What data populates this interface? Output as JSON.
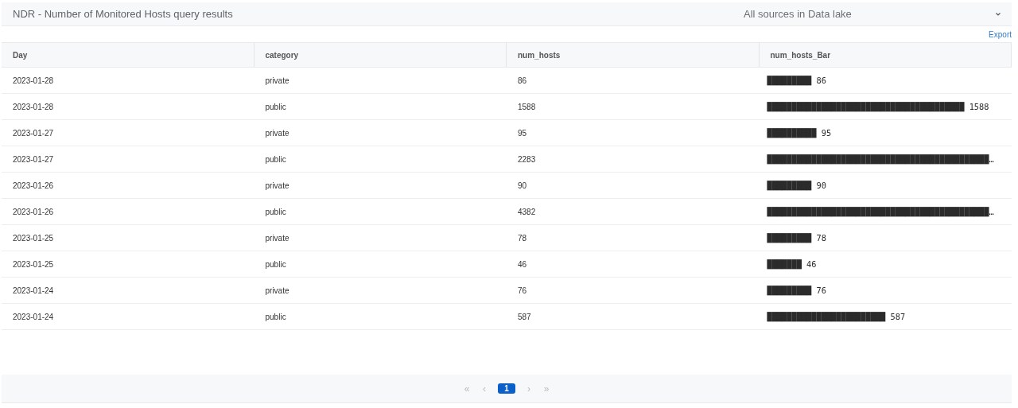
{
  "header": {
    "title": "NDR - Number of Monitored Hosts query results",
    "source_select": {
      "value": "All sources in Data lake"
    }
  },
  "export_link": "Export",
  "table": {
    "columns": [
      "Day",
      "category",
      "num_hosts",
      "num_hosts_Bar"
    ],
    "rows": [
      {
        "day": "2023-01-28",
        "category": "private",
        "num_hosts": "86",
        "num_hosts_bar": "█████████ 86"
      },
      {
        "day": "2023-01-28",
        "category": "public",
        "num_hosts": "1588",
        "num_hosts_bar": "████████████████████████████████████████ 1588"
      },
      {
        "day": "2023-01-27",
        "category": "private",
        "num_hosts": "95",
        "num_hosts_bar": "██████████ 95"
      },
      {
        "day": "2023-01-27",
        "category": "public",
        "num_hosts": "2283",
        "num_hosts_bar": "█████████████████████████████████████████████…"
      },
      {
        "day": "2023-01-26",
        "category": "private",
        "num_hosts": "90",
        "num_hosts_bar": "█████████ 90"
      },
      {
        "day": "2023-01-26",
        "category": "public",
        "num_hosts": "4382",
        "num_hosts_bar": "█████████████████████████████████████████████…"
      },
      {
        "day": "2023-01-25",
        "category": "private",
        "num_hosts": "78",
        "num_hosts_bar": "█████████ 78"
      },
      {
        "day": "2023-01-25",
        "category": "public",
        "num_hosts": "46",
        "num_hosts_bar": "███████ 46"
      },
      {
        "day": "2023-01-24",
        "category": "private",
        "num_hosts": "76",
        "num_hosts_bar": "█████████ 76"
      },
      {
        "day": "2023-01-24",
        "category": "public",
        "num_hosts": "587",
        "num_hosts_bar": "████████████████████████ 587"
      }
    ]
  },
  "pagination": [
    {
      "label": "«",
      "kind": "nav",
      "disabled": true,
      "selected": false
    },
    {
      "label": "‹",
      "kind": "nav",
      "disabled": true,
      "selected": false
    },
    {
      "label": "1",
      "kind": "page",
      "disabled": false,
      "selected": true
    },
    {
      "label": "›",
      "kind": "nav",
      "disabled": true,
      "selected": false
    },
    {
      "label": "»",
      "kind": "nav",
      "disabled": true,
      "selected": false
    }
  ]
}
